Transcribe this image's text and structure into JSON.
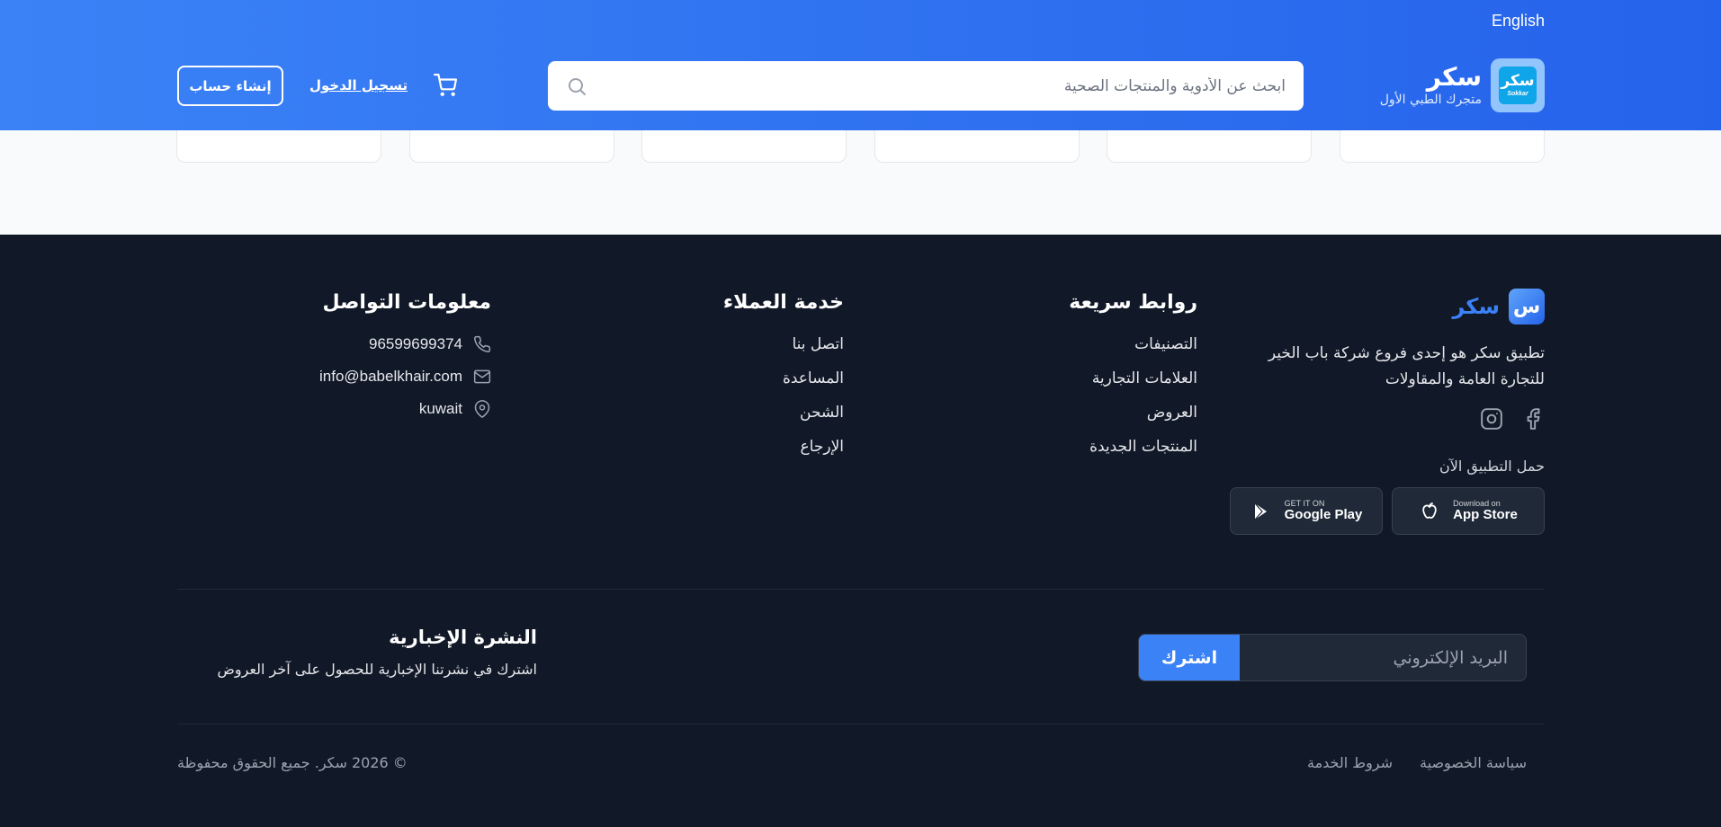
{
  "header": {
    "language_link": "English",
    "logo": {
      "badge_text": "سكر",
      "badge_subtext": "Sokkar",
      "title": "سكر",
      "subtitle": "متجرك الطبي الأول"
    },
    "search": {
      "placeholder": "ابحث عن الأدوية والمنتجات الصحية",
      "value": ""
    },
    "cart_icon": "cart-icon",
    "login_label": "تسجيل الدخول",
    "signup_label": "إنشاء حساب"
  },
  "footer": {
    "brand": {
      "badge_letter": "س",
      "name": "سكر",
      "description": "تطبيق سكر هو إحدى فروع شركة باب الخير للتجارة العامة والمقاولات",
      "socials": [
        "facebook-icon",
        "instagram-icon"
      ],
      "download_title": "حمل التطبيق الآن",
      "app_store": {
        "small": "Download on",
        "label": "App Store"
      },
      "google_play": {
        "small": "GET IT ON",
        "label": "Google Play"
      }
    },
    "quick_links": {
      "title": "روابط سريعة",
      "items": [
        "التصنيفات",
        "العلامات التجارية",
        "العروض",
        "المنتجات الجديدة"
      ]
    },
    "customer_service": {
      "title": "خدمة العملاء",
      "items": [
        "اتصل بنا",
        "المساعدة",
        "الشحن",
        "الإرجاع"
      ]
    },
    "contact": {
      "title": "معلومات التواصل",
      "phone": "96599699374",
      "email": "info@babelkhair.com",
      "location": "kuwait"
    },
    "newsletter": {
      "title": "النشرة الإخبارية",
      "description": "اشترك في نشرتنا الإخبارية للحصول على آخر العروض",
      "email_placeholder": "البريد الإلكتروني",
      "subscribe_label": "اشترك"
    },
    "bottom": {
      "privacy_label": "سياسة الخصوصية",
      "terms_label": "شروط الخدمة",
      "copyright": "© 2026 سكر. جميع الحقوق محفوظة"
    }
  },
  "colors": {
    "header_gradient_start": "#3b82f6",
    "header_gradient_end": "#2563eb",
    "footer_bg": "#111827",
    "accent": "#3b82f6"
  }
}
